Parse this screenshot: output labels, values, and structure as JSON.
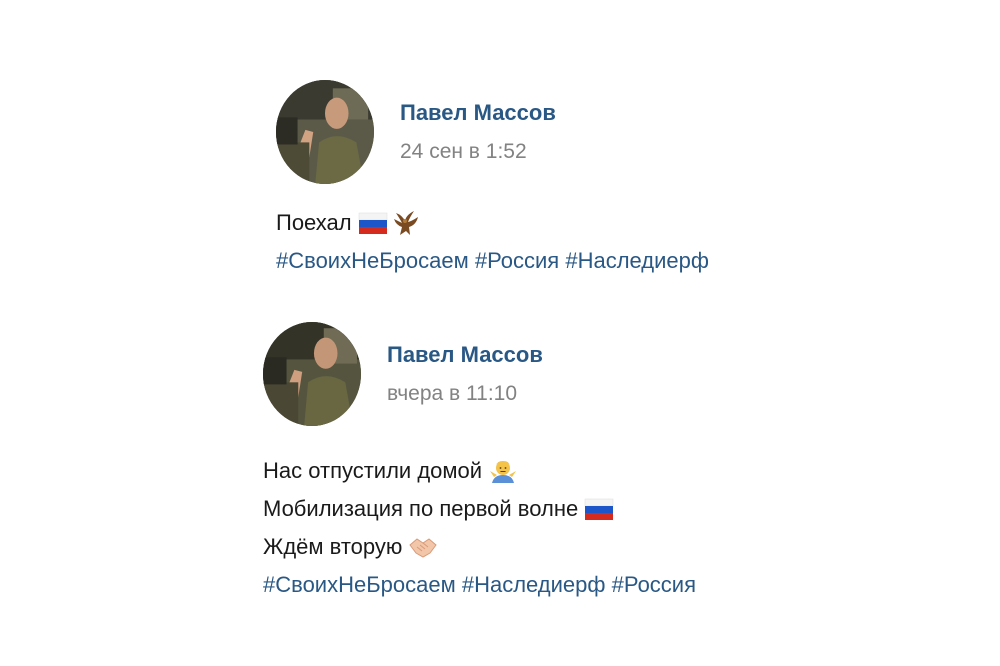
{
  "posts": [
    {
      "author": "Павел Массов",
      "date": "24 сен в 1:52",
      "lines": [
        {
          "text": "Поехал",
          "emoji": [
            "flag-russia-icon",
            "eagle-icon"
          ]
        }
      ],
      "hashtags": [
        "#СвоихНеБросаем",
        "#Россия",
        "#Наследиерф"
      ]
    },
    {
      "author": "Павел Массов",
      "date": "вчера в 11:10",
      "lines": [
        {
          "text": "Нас отпустили домой",
          "emoji": [
            "shrug-icon"
          ]
        },
        {
          "text": "Мобилизация по первой волне",
          "emoji": [
            "flag-russia-icon"
          ]
        },
        {
          "text": "Ждём вторую",
          "emoji": [
            "handshake-icon"
          ]
        }
      ],
      "hashtags": [
        "#СвоихНеБросаем",
        "#Наследиерф",
        "#Россия"
      ]
    }
  ],
  "colors": {
    "link": "#2a5885",
    "date": "#828282",
    "text": "#1a1a1a"
  }
}
